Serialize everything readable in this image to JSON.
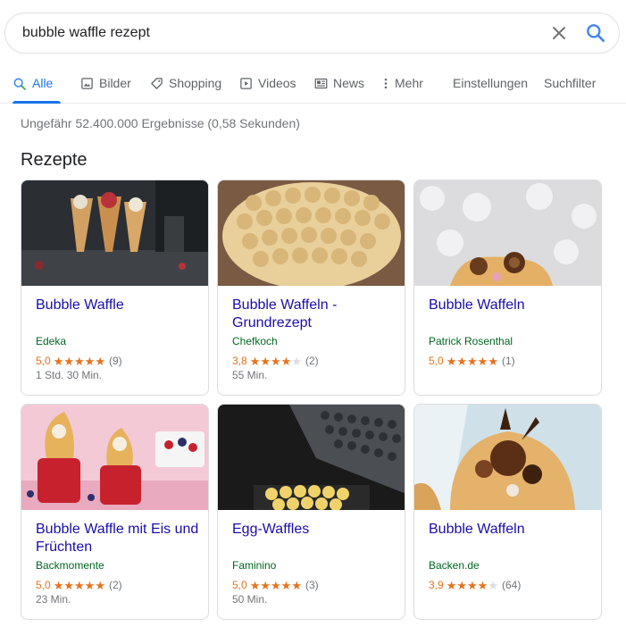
{
  "search": {
    "query": "bubble waffle rezept",
    "clear_icon": "close-icon",
    "search_icon": "search-icon",
    "accent_color": "#1a73e8"
  },
  "tabs": [
    {
      "label": "Alle",
      "icon": "search-icon",
      "active": true
    },
    {
      "label": "Bilder",
      "icon": "image-icon"
    },
    {
      "label": "Shopping",
      "icon": "tag-icon"
    },
    {
      "label": "Videos",
      "icon": "play-icon"
    },
    {
      "label": "News",
      "icon": "newspaper-icon"
    },
    {
      "label": "Mehr",
      "icon": "more-vert-icon"
    },
    {
      "label": "Einstellungen"
    },
    {
      "label": "Suchfilter"
    }
  ],
  "result_stats": "Ungefähr 52.400.000 Ergebnisse (0,58 Sekunden)",
  "recipes": {
    "title": "Rezepte",
    "star_color": "#e7711b",
    "cards": [
      {
        "title": "Bubble Waffle",
        "source": "Edeka",
        "rating": "5,0",
        "stars": 5,
        "count": "(9)",
        "time": "1 Std. 30 Min."
      },
      {
        "title": "Bubble Waffeln - Grundrezept",
        "source": "Chefkoch",
        "rating": "3,8",
        "stars": 4,
        "count": "(2)",
        "time": "55 Min."
      },
      {
        "title": "Bubble Waffeln",
        "source": "Patrick Rosenthal",
        "rating": "5,0",
        "stars": 5,
        "count": "(1)",
        "time": ""
      },
      {
        "title": "Bubble Waffle mit Eis und Früchten",
        "source": "Backmomente",
        "rating": "5,0",
        "stars": 5,
        "count": "(2)",
        "time": "23 Min."
      },
      {
        "title": "Egg-Waffles",
        "source": "Faminino",
        "rating": "5,0",
        "stars": 5,
        "count": "(3)",
        "time": "50 Min."
      },
      {
        "title": "Bubble Waffeln",
        "source": "Backen.de",
        "rating": "3,9",
        "stars": 4,
        "count": "(64)",
        "time": ""
      }
    ]
  }
}
